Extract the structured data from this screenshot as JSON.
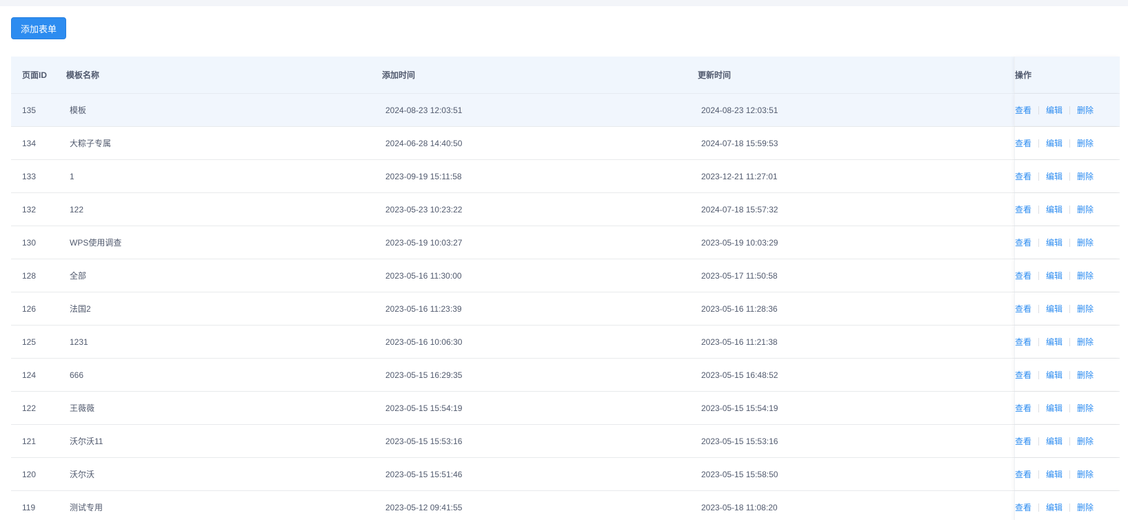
{
  "toolbar": {
    "add_label": "添加表单"
  },
  "table": {
    "headers": {
      "id": "页面ID",
      "name": "模板名称",
      "added": "添加时间",
      "updated": "更新时间",
      "ops": "操作"
    },
    "actions": {
      "view": "查看",
      "edit": "编辑",
      "delete": "删除"
    },
    "rows": [
      {
        "id": "135",
        "name": "模板",
        "added": "2024-08-23 12:03:51",
        "updated": "2024-08-23 12:03:51"
      },
      {
        "id": "134",
        "name": "大粽子专属",
        "added": "2024-06-28 14:40:50",
        "updated": "2024-07-18 15:59:53"
      },
      {
        "id": "133",
        "name": "1",
        "added": "2023-09-19 15:11:58",
        "updated": "2023-12-21 11:27:01"
      },
      {
        "id": "132",
        "name": "122",
        "added": "2023-05-23 10:23:22",
        "updated": "2024-07-18 15:57:32"
      },
      {
        "id": "130",
        "name": "WPS使用调查",
        "added": "2023-05-19 10:03:27",
        "updated": "2023-05-19 10:03:29"
      },
      {
        "id": "128",
        "name": "全部",
        "added": "2023-05-16 11:30:00",
        "updated": "2023-05-17 11:50:58"
      },
      {
        "id": "126",
        "name": "法国2",
        "added": "2023-05-16 11:23:39",
        "updated": "2023-05-16 11:28:36"
      },
      {
        "id": "125",
        "name": "1231",
        "added": "2023-05-16 10:06:30",
        "updated": "2023-05-16 11:21:38"
      },
      {
        "id": "124",
        "name": "666",
        "added": "2023-05-15 16:29:35",
        "updated": "2023-05-15 16:48:52"
      },
      {
        "id": "122",
        "name": "王薇薇",
        "added": "2023-05-15 15:54:19",
        "updated": "2023-05-15 15:54:19"
      },
      {
        "id": "121",
        "name": "沃尔沃11",
        "added": "2023-05-15 15:53:16",
        "updated": "2023-05-15 15:53:16"
      },
      {
        "id": "120",
        "name": "沃尔沃",
        "added": "2023-05-15 15:51:46",
        "updated": "2023-05-15 15:58:50"
      },
      {
        "id": "119",
        "name": "测试专用",
        "added": "2023-05-12 09:41:55",
        "updated": "2023-05-18 11:08:20"
      }
    ]
  },
  "colors": {
    "primary": "#2d8cf0",
    "header_bg": "#f0f6fd",
    "hover_row_bg": "#f1f6fd"
  }
}
